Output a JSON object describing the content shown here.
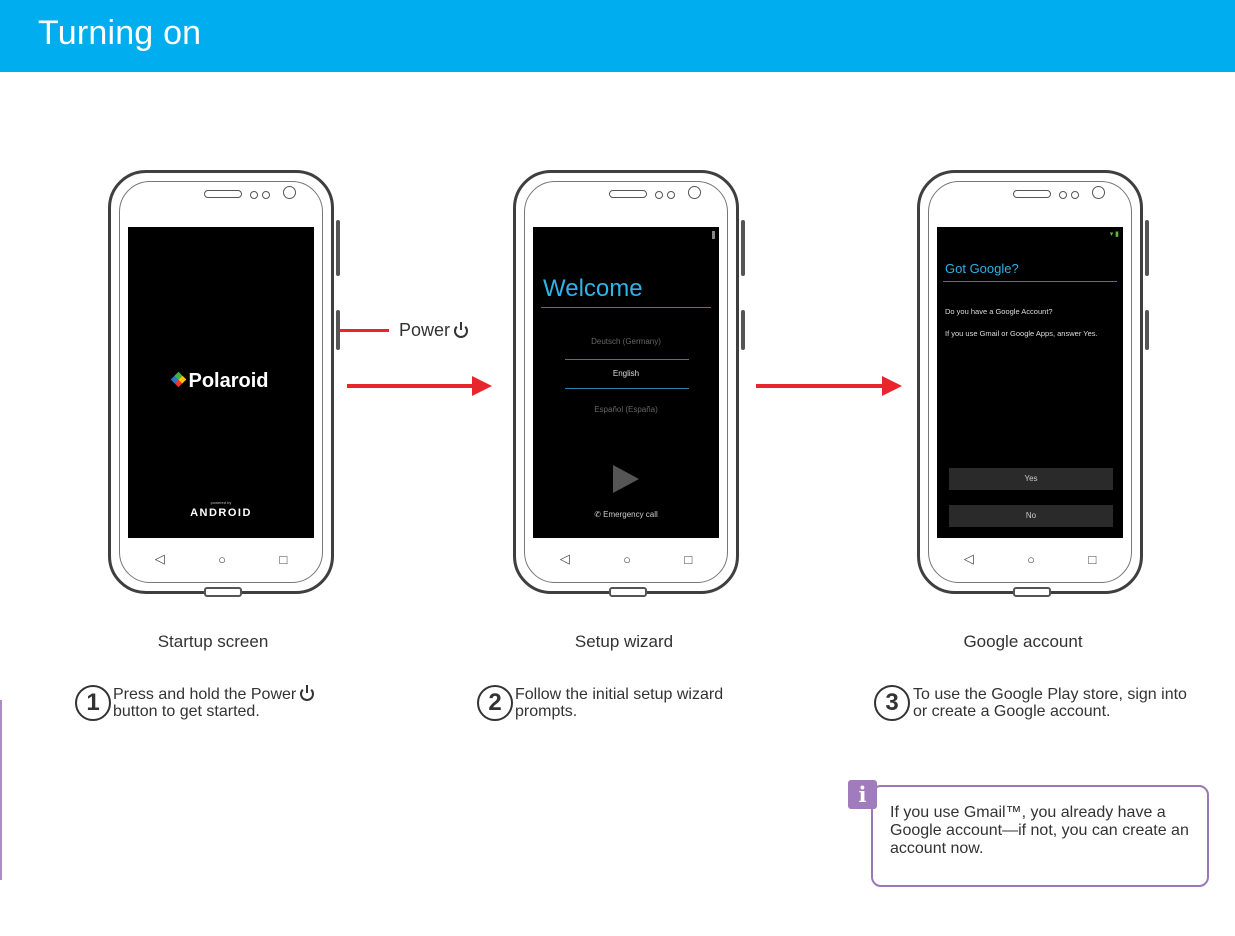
{
  "header": {
    "title": "Turning on"
  },
  "phone1": {
    "brand": "Polaroid",
    "powered_by": "powered by",
    "android": "ANDROID"
  },
  "phone2": {
    "title": "Welcome",
    "languages": [
      "Deutsch (Germany)",
      "English",
      "Español (España)"
    ],
    "emergency": "Emergency call"
  },
  "phone3": {
    "title": "Got Google?",
    "question": "Do you have a Google Account?",
    "hint": "If you use Gmail or Google Apps, answer Yes.",
    "yes": "Yes",
    "no": "No"
  },
  "nav_icons": [
    "back-icon",
    "home-icon",
    "recents-icon"
  ],
  "power_label": "Power",
  "steps": [
    {
      "number": "1",
      "caption": "Startup screen",
      "text_a": "Press and hold the Power",
      "text_b": "button to get started."
    },
    {
      "number": "2",
      "caption": "Setup wizard",
      "text": "Follow the initial setup wizard prompts."
    },
    {
      "number": "3",
      "caption": "Google account",
      "text": "To use the Google Play store, sign into or create a Google account."
    }
  ],
  "info": {
    "badge": "i",
    "text": "If you use Gmail™, you already have a Google account—if not, you can create an account now."
  },
  "colors": {
    "header": "#00aeef",
    "arrow": "#e8252b",
    "info_accent": "#9b77b8",
    "screen_accent": "#2fb2e6"
  }
}
